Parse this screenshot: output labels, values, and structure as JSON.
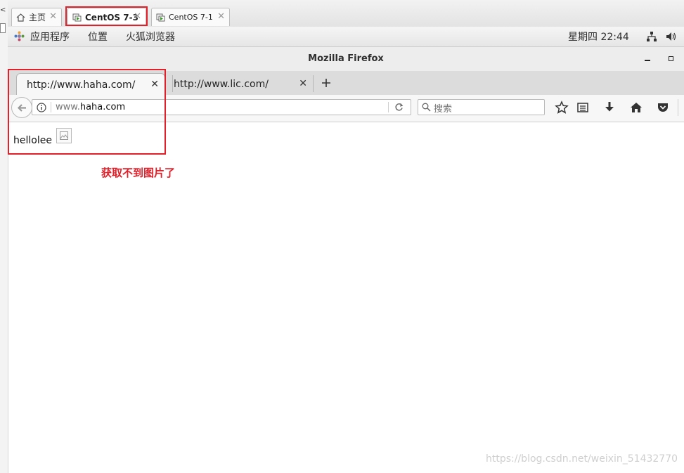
{
  "vm_tabs": [
    {
      "label": "主页",
      "active": false
    },
    {
      "label": "CentOS 7-3",
      "active": true
    },
    {
      "label": "CentOS 7-1",
      "active": false
    }
  ],
  "gnome": {
    "menu_apps": "应用程序",
    "menu_places": "位置",
    "menu_browser": "火狐浏览器",
    "clock": "星期四 22:44"
  },
  "window_title": "Mozilla Firefox",
  "browser_tabs": [
    {
      "label": "http://www.haha.com/"
    },
    {
      "label": "http://www.lic.com/"
    }
  ],
  "url": {
    "prefix": "www.",
    "host": "haha.com"
  },
  "search_placeholder": "搜索",
  "page": {
    "text": "hellolee"
  },
  "annotation": "获取不到图片了",
  "watermark": "https://blog.csdn.net/weixin_51432770",
  "colors": {
    "highlight": "#e3202a"
  }
}
